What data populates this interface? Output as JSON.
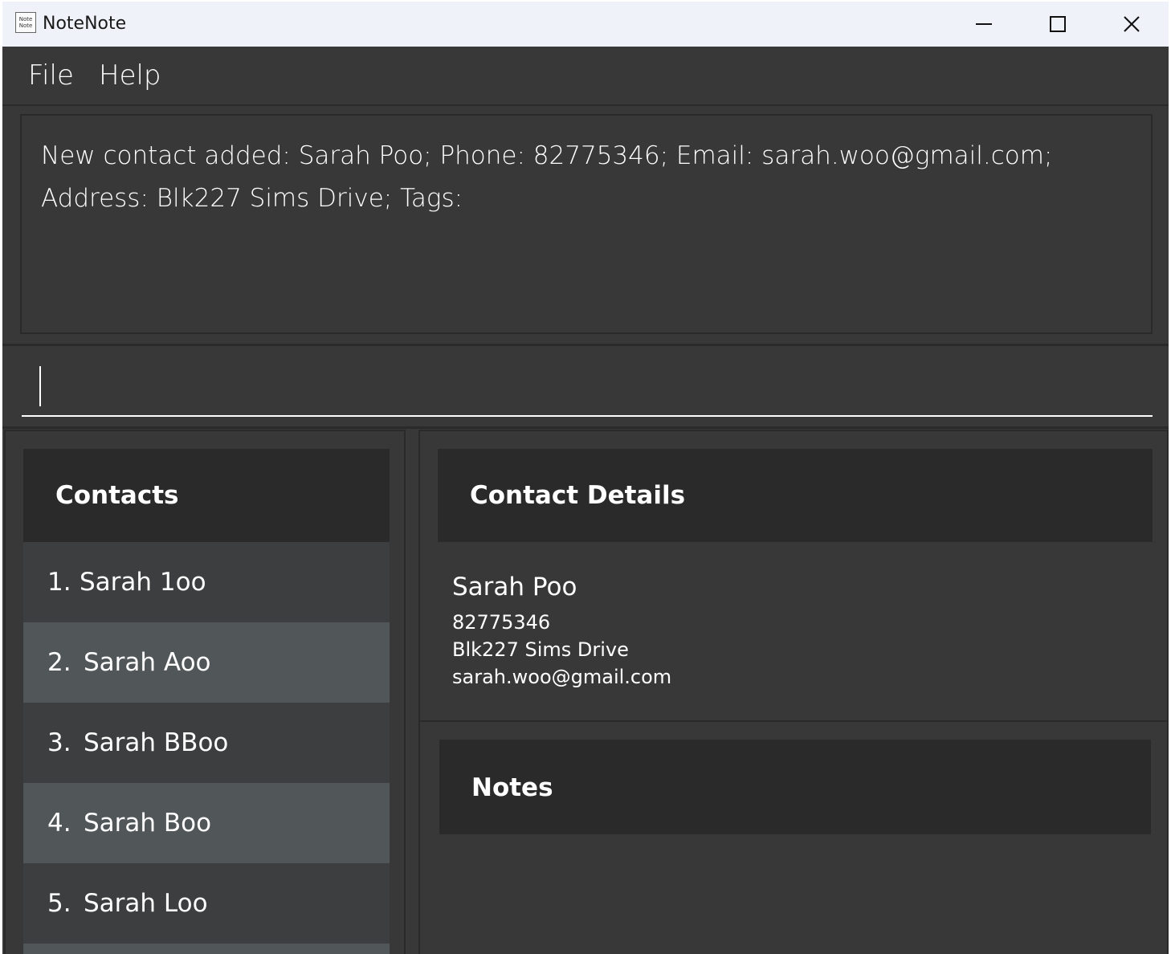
{
  "window": {
    "title": "NoteNote",
    "icon_text": "Note Note"
  },
  "menu": {
    "file": "File",
    "help": "Help"
  },
  "result": {
    "text": "New contact added: Sarah Poo; Phone: 82775346; Email: sarah.woo@gmail.com; Address: Blk227 Sims Drive; Tags:"
  },
  "command": {
    "value": ""
  },
  "contacts": {
    "title": "Contacts",
    "items": [
      {
        "index": "1.",
        "name": "Sarah 1oo"
      },
      {
        "index": "2.",
        "name": "Sarah Aoo"
      },
      {
        "index": "3.",
        "name": "Sarah BBoo"
      },
      {
        "index": "4.",
        "name": "Sarah Boo"
      },
      {
        "index": "5.",
        "name": "Sarah Loo"
      }
    ]
  },
  "details": {
    "title": "Contact Details",
    "name": "Sarah Poo",
    "phone": "82775346",
    "address": "Blk227 Sims Drive",
    "email": "sarah.woo@gmail.com"
  },
  "notes": {
    "title": "Notes"
  },
  "colors": {
    "background": "#383838",
    "header": "#2a2a2a",
    "row_odd": "#3c3e3f",
    "row_even": "#515658",
    "titlebar": "#eff2f9"
  }
}
